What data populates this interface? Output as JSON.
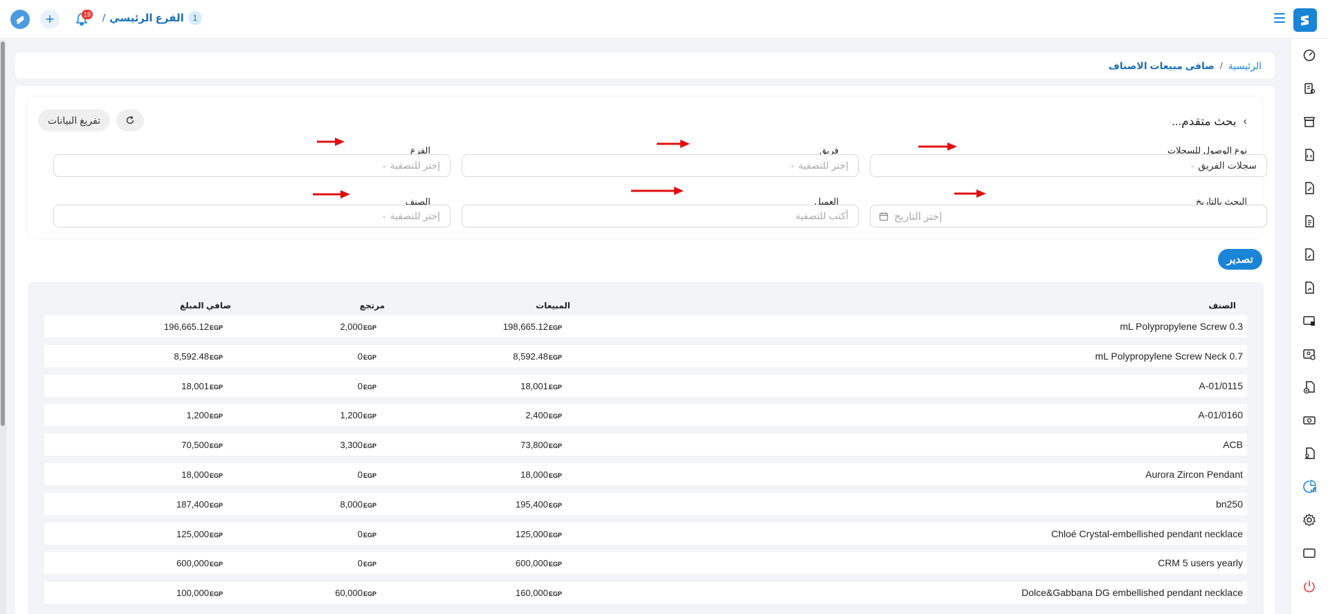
{
  "topbar": {
    "branch_badge": "1",
    "branch_name": "الفرع الرئيسي",
    "branch_separator": "/",
    "notification_count": "19"
  },
  "breadcrumb": {
    "home": "الرئيسية",
    "separator": "/",
    "current": "صافى مبيعات الاصناف"
  },
  "filters": {
    "title": "بحث متقدم...",
    "clear_label": "تفريغ البيانات",
    "access_type": {
      "label": "نوع الوصول للسجلات",
      "value": "سجلات الفريق"
    },
    "team": {
      "label": "فريق",
      "placeholder": "إختر للتصفية"
    },
    "branch": {
      "label": "الفرع",
      "placeholder": "إختر للتصفية"
    },
    "date": {
      "label": "البحث بالتاريخ",
      "placeholder": "إختر التاريخ"
    },
    "customer": {
      "label": "العميل",
      "placeholder": "أكتب للتصفية"
    },
    "item": {
      "label": "الصنف",
      "placeholder": "إختر للتصفية"
    }
  },
  "export_label": "تصدير",
  "table": {
    "currency": "EGP",
    "headers": {
      "item": "الصنف",
      "sales": "المبيعات",
      "returns": "مرتجع",
      "net": "صافي المبلغ"
    },
    "rows": [
      {
        "item": "mL Polypropylene Screw 0.3",
        "sales": "198,665.12",
        "returns": "2,000",
        "net": "196,665.12"
      },
      {
        "item": "mL Polypropylene Screw Neck 0.7",
        "sales": "8,592.48",
        "returns": "0",
        "net": "8,592.48"
      },
      {
        "item": "A-01/0115",
        "sales": "18,001",
        "returns": "0",
        "net": "18,001"
      },
      {
        "item": "A-01/0160",
        "sales": "2,400",
        "returns": "1,200",
        "net": "1,200"
      },
      {
        "item": "ACB",
        "sales": "73,800",
        "returns": "3,300",
        "net": "70,500"
      },
      {
        "item": "Aurora Zircon Pendant",
        "sales": "18,000",
        "returns": "0",
        "net": "18,000"
      },
      {
        "item": "bn250",
        "sales": "195,400",
        "returns": "8,000",
        "net": "187,400"
      },
      {
        "item": "Chloé Crystal-embellished pendant necklace",
        "sales": "125,000",
        "returns": "0",
        "net": "125,000"
      },
      {
        "item": "CRM 5 users yearly",
        "sales": "600,000",
        "returns": "0",
        "net": "600,000"
      },
      {
        "item": "Dolce&Gabbana DG embellished pendant necklace",
        "sales": "160,000",
        "returns": "60,000",
        "net": "100,000"
      }
    ]
  },
  "colors": {
    "accent": "#1a84d6",
    "danger": "#e53935",
    "arrow": "#e01010"
  }
}
